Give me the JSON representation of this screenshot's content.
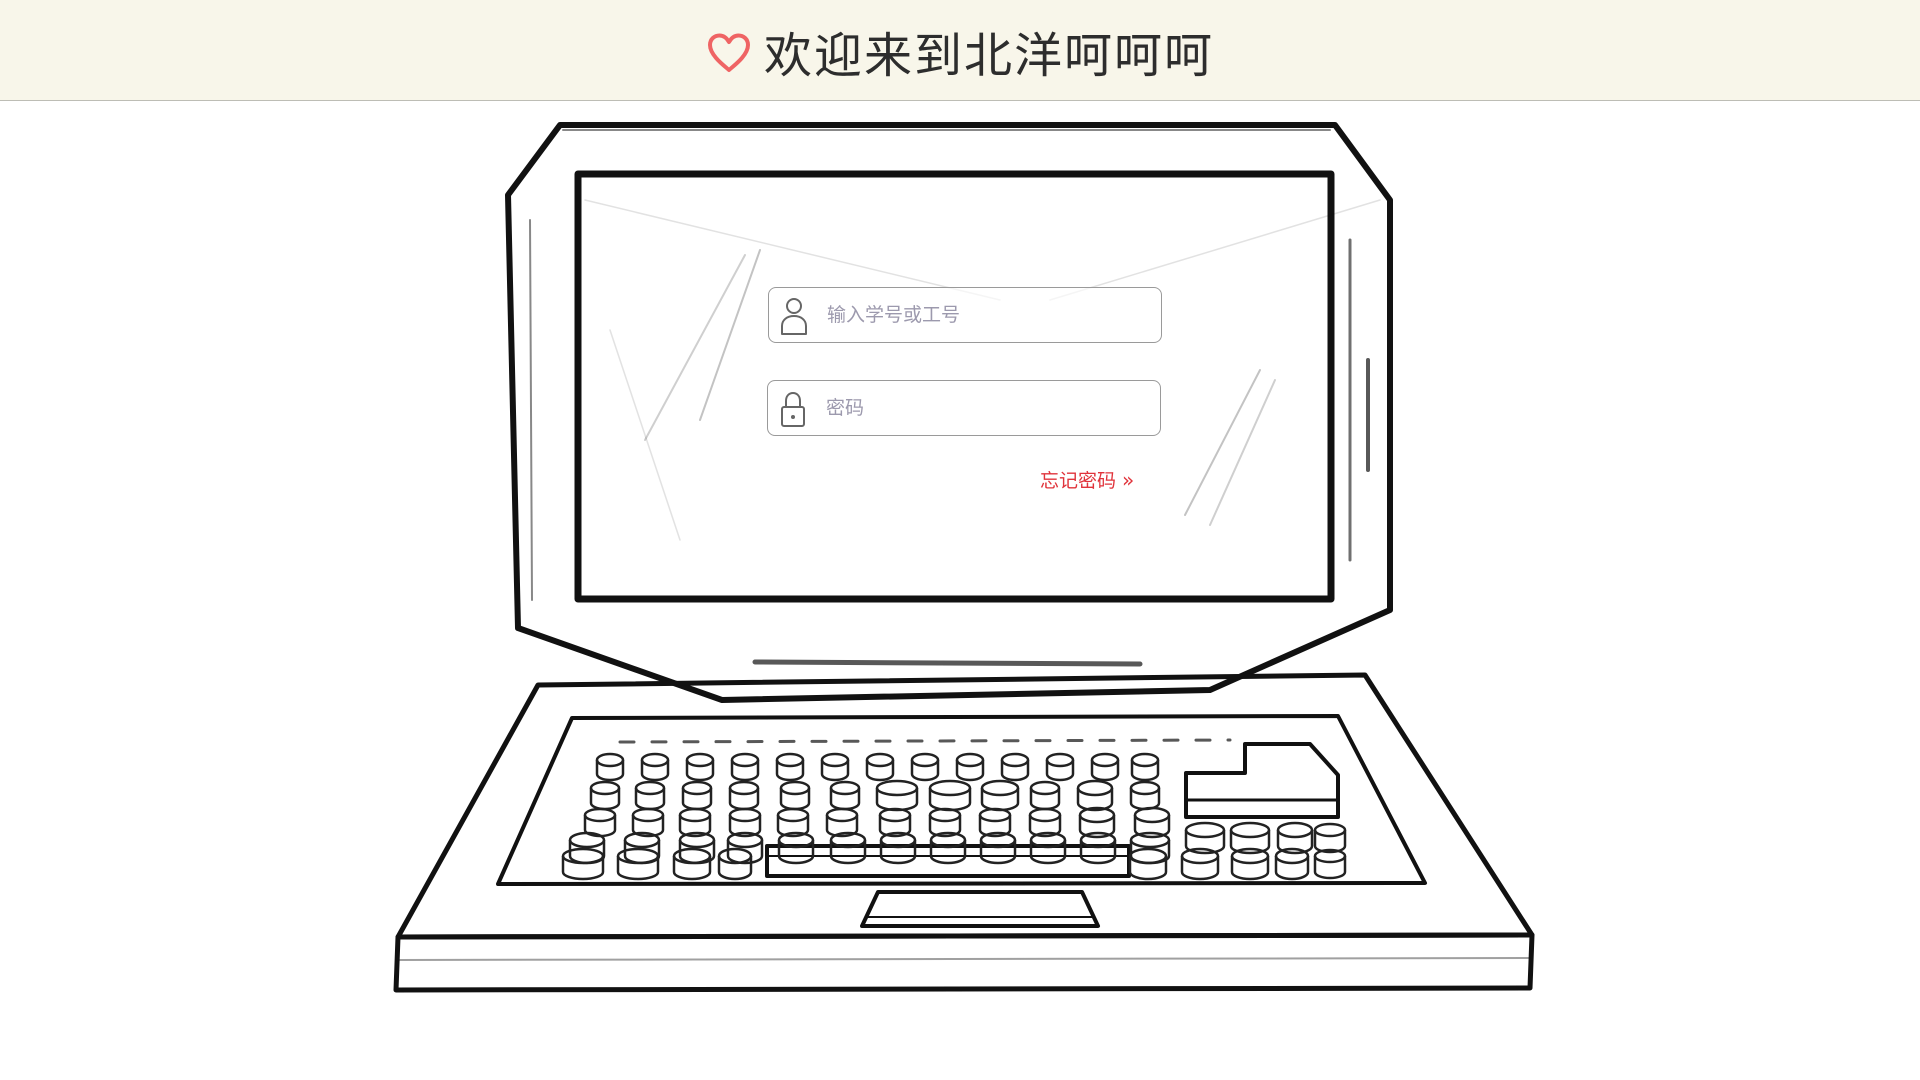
{
  "header": {
    "title": "欢迎来到北洋呵呵呵",
    "icon": "heart-icon",
    "accent_color": "#ef6464"
  },
  "login": {
    "username_placeholder": "输入学号或工号",
    "username_icon": "user-icon",
    "password_placeholder": "密码",
    "password_icon": "lock-icon",
    "forgot_label": "忘记密码",
    "forgot_icon": "double-chevron-right-icon",
    "forgot_color": "#e0333b"
  }
}
